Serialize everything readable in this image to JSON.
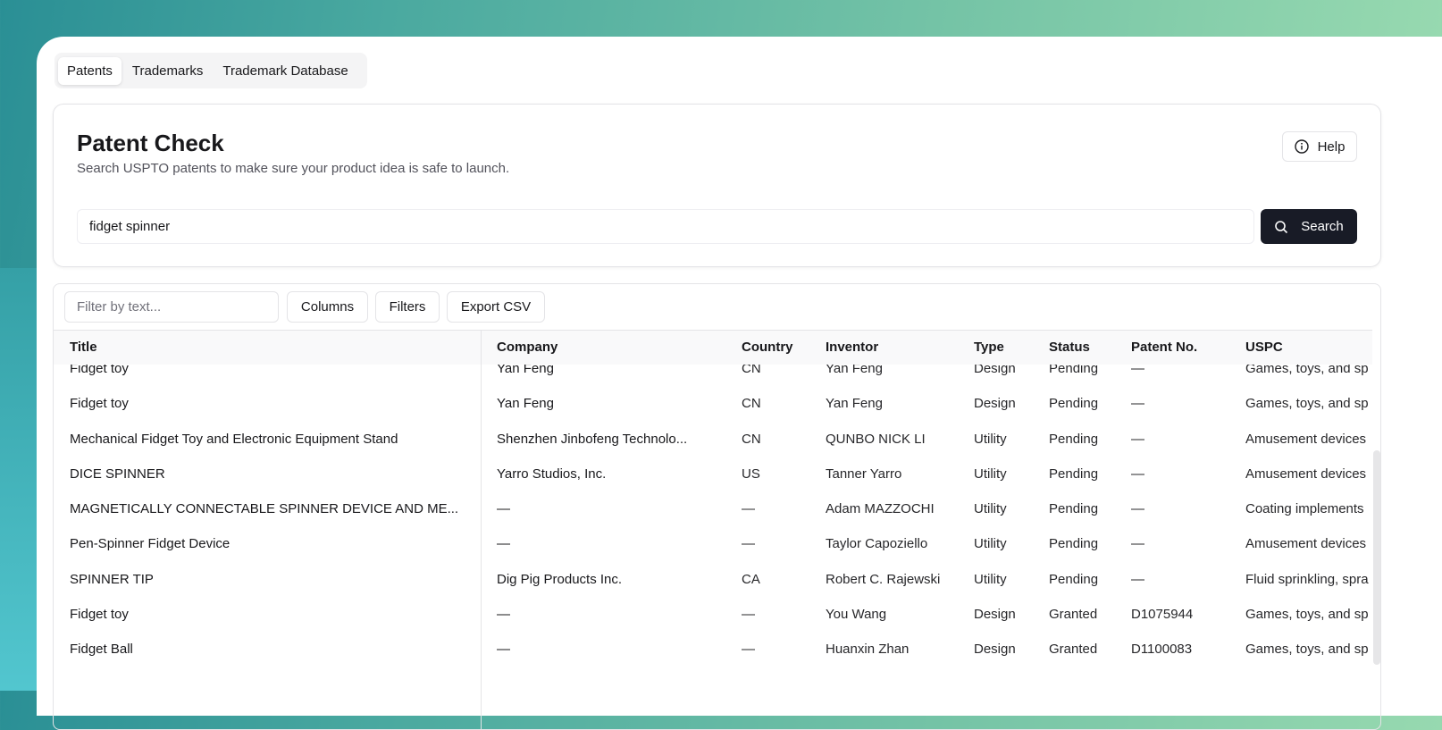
{
  "tabs": [
    {
      "label": "Patents",
      "active": true
    },
    {
      "label": "Trademarks"
    },
    {
      "label": "Trademark Database"
    }
  ],
  "header": {
    "title": "Patent Check",
    "subtitle": "Search USPTO patents to make sure your product idea is safe to launch.",
    "help_label": "Help"
  },
  "search": {
    "value": "fidget spinner",
    "button_label": "Search"
  },
  "toolbar": {
    "filter_placeholder": "Filter by text...",
    "columns_label": "Columns",
    "filters_label": "Filters",
    "export_label": "Export CSV"
  },
  "table": {
    "columns": [
      "Title",
      "Company",
      "Country",
      "Inventor",
      "Type",
      "Status",
      "Patent No.",
      "USPC"
    ],
    "rows": [
      [
        "Fidget toy",
        "Yan Feng",
        "CN",
        "Yan Feng",
        "Design",
        "Pending",
        "—",
        "Games, toys, and sp"
      ],
      [
        "Fidget toy",
        "Yan Feng",
        "CN",
        "Yan Feng",
        "Design",
        "Pending",
        "—",
        "Games, toys, and sp"
      ],
      [
        "Mechanical Fidget Toy and Electronic Equipment Stand",
        "Shenzhen Jinbofeng Technolo...",
        "CN",
        "QUNBO NICK LI",
        "Utility",
        "Pending",
        "—",
        "Amusement devices"
      ],
      [
        "DICE SPINNER",
        "Yarro Studios, Inc.",
        "US",
        "Tanner Yarro",
        "Utility",
        "Pending",
        "—",
        "Amusement devices"
      ],
      [
        "MAGNETICALLY CONNECTABLE SPINNER DEVICE AND ME...",
        "—",
        "—",
        "Adam MAZZOCHI",
        "Utility",
        "Pending",
        "—",
        "Coating implements"
      ],
      [
        "Pen-Spinner Fidget Device",
        "—",
        "—",
        "Taylor Capoziello",
        "Utility",
        "Pending",
        "—",
        "Amusement devices"
      ],
      [
        "SPINNER TIP",
        "Dig Pig Products Inc.",
        "CA",
        "Robert C. Rajewski",
        "Utility",
        "Pending",
        "—",
        "Fluid sprinkling, spra"
      ],
      [
        "Fidget toy",
        "—",
        "—",
        "You Wang",
        "Design",
        "Granted",
        "D1075944",
        "Games, toys, and sp"
      ],
      [
        "Fidget Ball",
        "—",
        "—",
        "Huanxin Zhan",
        "Design",
        "Granted",
        "D1100083",
        "Games, toys, and sp"
      ]
    ]
  }
}
